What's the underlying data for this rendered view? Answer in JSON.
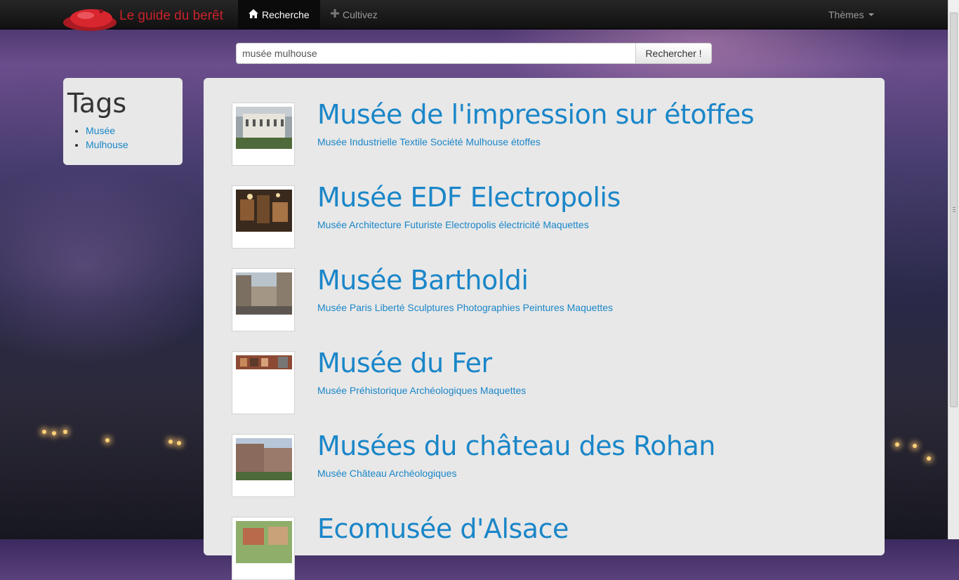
{
  "navbar": {
    "brand": "Le guide du berêt",
    "brand_icon": "beret-logo-icon",
    "items": [
      {
        "label": "Recherche",
        "icon": "home-icon",
        "active": true
      },
      {
        "label": "Cultivez",
        "icon": "plus-icon",
        "active": false
      }
    ],
    "themes_label": "Thèmes"
  },
  "search": {
    "value": "musée mulhouse",
    "button_label": "Rechercher !"
  },
  "tags": {
    "title": "Tags",
    "items": [
      "Musée",
      "Mulhouse"
    ]
  },
  "results": [
    {
      "title": "Musée de l'impression sur étoffes",
      "tags": "Musée Industrielle Textile Société Mulhouse étoffes"
    },
    {
      "title": "Musée EDF Electropolis",
      "tags": "Musée Architecture Futuriste Electropolis électricité Maquettes"
    },
    {
      "title": "Musée Bartholdi",
      "tags": "Musée Paris Liberté Sculptures Photographies Peintures Maquettes"
    },
    {
      "title": "Musée du Fer",
      "tags": "Musée Préhistorique Archéologiques Maquettes"
    },
    {
      "title": "Musées du château des Rohan",
      "tags": "Musée Château Archéologiques"
    },
    {
      "title": "Ecomusée d'Alsace",
      "tags": ""
    }
  ],
  "colors": {
    "link": "#1a86c8",
    "brand": "#c8232b",
    "panel": "#e8e8e8"
  }
}
